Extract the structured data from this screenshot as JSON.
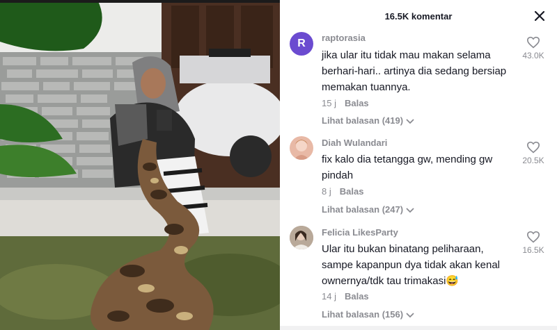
{
  "header": {
    "comment_count": "16.5K komentar",
    "close_icon": "close-icon"
  },
  "comments": [
    {
      "username": "raptorasia",
      "avatar_letter": "R",
      "avatar_color": "#6b4bd0",
      "text": "jika ular itu tidak mau makan selama berhari-hari.. artinya dia sedang bersiap memakan tuannya.",
      "time": "15 j",
      "reply_label": "Balas",
      "view_replies": "Lihat balasan (419)",
      "likes": "43.0K"
    },
    {
      "username": "Diah Wulandari",
      "avatar_color": "#e8b9a6",
      "text": "fix kalo dia tetangga gw, mending gw pindah",
      "time": "8 j",
      "reply_label": "Balas",
      "view_replies": "Lihat balasan (247)",
      "likes": "20.5K"
    },
    {
      "username": "Felicia LikesParty",
      "avatar_color": "#8c7a6d",
      "text": "Ular itu bukan binatang peliharaan, sampe kapanpun dya tidak akan kenal ownernya/tdk tau trimakasi😅",
      "time": "14 j",
      "reply_label": "Balas",
      "view_replies": "Lihat balasan (156)",
      "likes": "16.5K"
    }
  ]
}
